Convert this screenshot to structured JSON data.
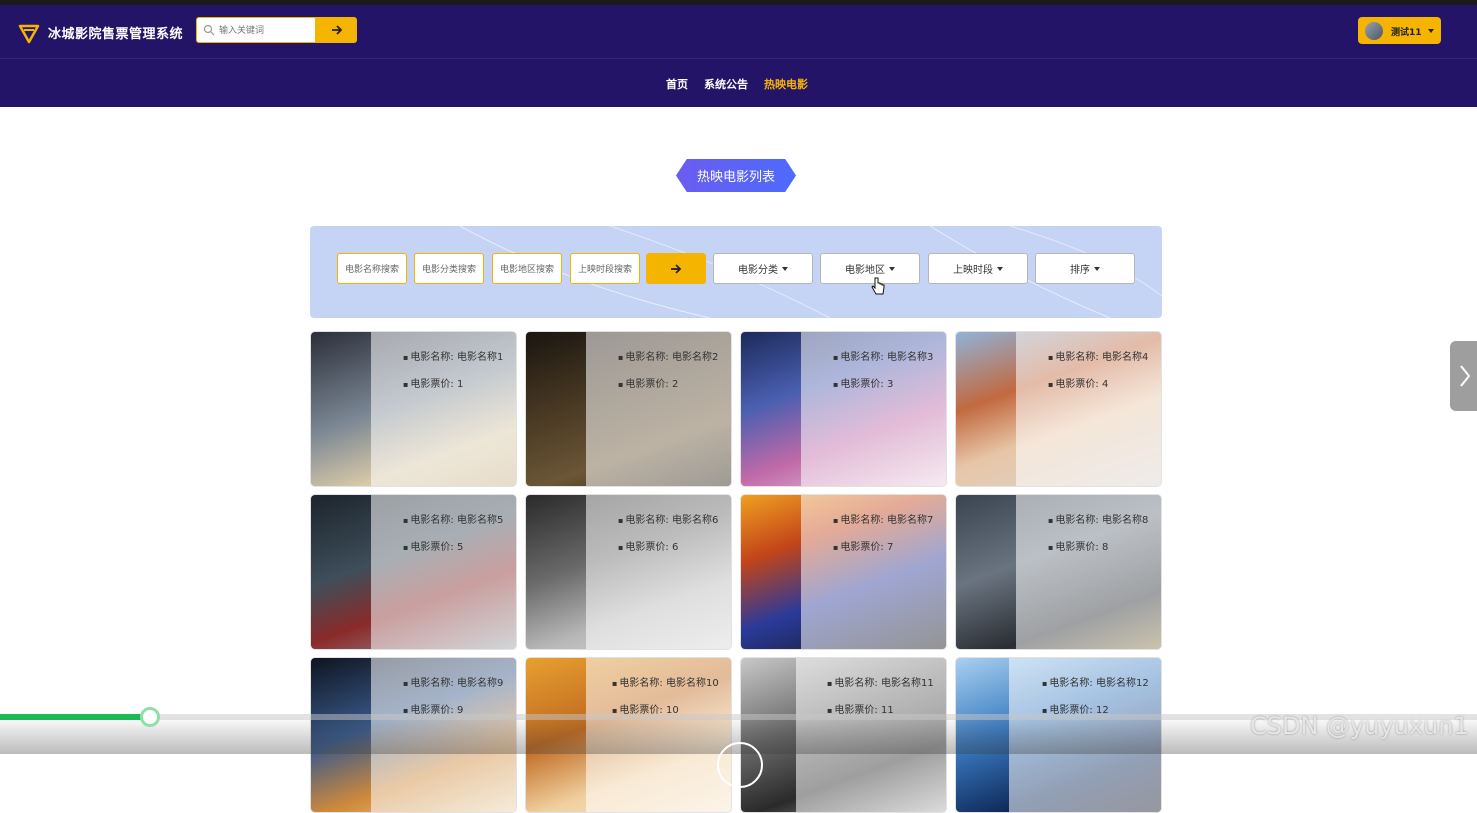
{
  "header": {
    "title": "冰城影院售票管理系统",
    "search_placeholder": "输入关键词",
    "user_name": "测试11"
  },
  "nav": {
    "items": [
      {
        "label": "首页",
        "active": false
      },
      {
        "label": "系统公告",
        "active": false
      },
      {
        "label": "热映电影",
        "active": true
      }
    ]
  },
  "section": {
    "title": "热映电影列表"
  },
  "filters": {
    "inputs": [
      "电影名称搜索",
      "电影分类搜索",
      "电影地区搜索",
      "上映时段搜索"
    ],
    "dropdowns": [
      "电影分类",
      "电影地区",
      "上映时段",
      "排序"
    ]
  },
  "movies": [
    {
      "name_label": "电影名称: 电影名称1",
      "price_label": "电影票价: 1"
    },
    {
      "name_label": "电影名称: 电影名称2",
      "price_label": "电影票价: 2"
    },
    {
      "name_label": "电影名称: 电影名称3",
      "price_label": "电影票价: 3"
    },
    {
      "name_label": "电影名称: 电影名称4",
      "price_label": "电影票价: 4"
    },
    {
      "name_label": "电影名称: 电影名称5",
      "price_label": "电影票价: 5"
    },
    {
      "name_label": "电影名称: 电影名称6",
      "price_label": "电影票价: 6"
    },
    {
      "name_label": "电影名称: 电影名称7",
      "price_label": "电影票价: 7"
    },
    {
      "name_label": "电影名称: 电影名称8",
      "price_label": "电影票价: 8"
    },
    {
      "name_label": "电影名称: 电影名称9",
      "price_label": "电影票价: 9"
    },
    {
      "name_label": "电影名称: 电影名称10",
      "price_label": "电影票价: 10"
    },
    {
      "name_label": "电影名称: 电影名称11",
      "price_label": "电影票价: 11"
    },
    {
      "name_label": "电影名称: 电影名称12",
      "price_label": "电影票价: 12"
    }
  ],
  "video_player": {
    "progress": 0.1
  },
  "watermark": "CSDN @yuyuxun1",
  "colors": {
    "header_bg": "#241468",
    "accent": "#f5b400",
    "filter_bg": "#c5d3f5"
  }
}
